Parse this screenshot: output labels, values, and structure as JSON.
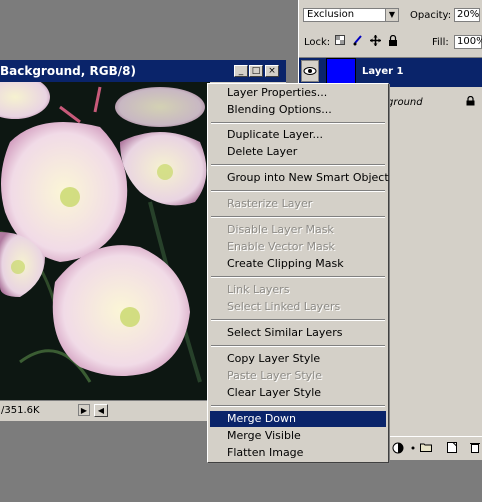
{
  "layers_panel": {
    "blend_mode": "Exclusion",
    "opacity_label": "Opacity:",
    "opacity_value": "20%",
    "lock_label": "Lock:",
    "fill_label": "Fill:",
    "fill_value": "100%",
    "layers": [
      {
        "name": "Layer 1",
        "color": "#0000ff"
      },
      {
        "name": "ground"
      }
    ]
  },
  "document": {
    "title": "Background, RGB/8)",
    "status_size": "/351.6K"
  },
  "context_menu": {
    "items": [
      {
        "label": "Layer Properties..."
      },
      {
        "label": "Blending Options..."
      },
      {
        "label": "Duplicate Layer..."
      },
      {
        "label": "Delete Layer"
      },
      {
        "label": "Group into New Smart Object"
      },
      {
        "label": "Rasterize Layer"
      },
      {
        "label": "Disable Layer Mask"
      },
      {
        "label": "Enable Vector Mask"
      },
      {
        "label": "Create Clipping Mask"
      },
      {
        "label": "Link Layers"
      },
      {
        "label": "Select Linked Layers"
      },
      {
        "label": "Select Similar Layers"
      },
      {
        "label": "Copy Layer Style"
      },
      {
        "label": "Paste Layer Style"
      },
      {
        "label": "Clear Layer Style"
      },
      {
        "label": "Merge Down"
      },
      {
        "label": "Merge Visible"
      },
      {
        "label": "Flatten Image"
      }
    ]
  },
  "colors": {
    "highlight": "#0a246a",
    "panel_bg": "#d4d0c8",
    "workspace": "#7c7c7c"
  }
}
